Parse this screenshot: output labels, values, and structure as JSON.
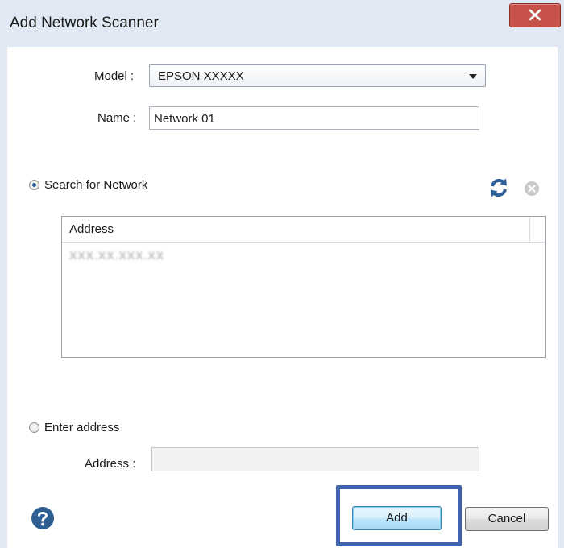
{
  "window": {
    "title": "Add Network Scanner",
    "close_glyph": "x"
  },
  "form": {
    "model_label": "Model :",
    "model_value": "EPSON XXXXX",
    "name_label": "Name :",
    "name_value": "Network 01"
  },
  "search": {
    "radio_label": "Search for Network",
    "radio_checked": true,
    "refresh_icon": "refresh-icon",
    "cancel_icon": "cancel-icon"
  },
  "address_list": {
    "column_header": "Address",
    "rows": [
      "XXX.XX.XXX.XX"
    ]
  },
  "enter_address": {
    "radio_label": "Enter address",
    "radio_checked": false,
    "address_label": "Address :",
    "address_value": ""
  },
  "footer": {
    "help_icon": "help-icon",
    "add_label": "Add",
    "cancel_label": "Cancel"
  },
  "colors": {
    "titlebar": "#dfe8f3",
    "close_button": "#c7524a",
    "highlight_frame": "#3f64ad",
    "help_icon": "#2f5e93",
    "refresh_icon": "#2e5f96"
  }
}
